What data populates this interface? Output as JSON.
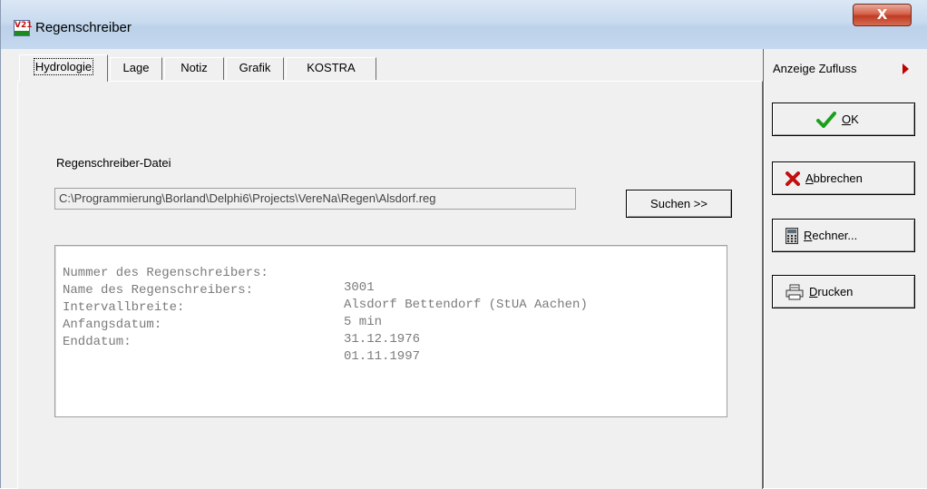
{
  "window": {
    "title": "Regenschreiber",
    "app_icon_text": "V21",
    "close_glyph": "X"
  },
  "tabs": [
    {
      "label": "Hydrologie",
      "active": true
    },
    {
      "label": "Lage"
    },
    {
      "label": "Notiz"
    },
    {
      "label": "Grafik"
    },
    {
      "label": "KOSTRA"
    }
  ],
  "side": {
    "toggle_label": "Anzeige Zufluss",
    "ok_mnemonic": "O",
    "ok_rest": "K",
    "cancel_mnemonic": "A",
    "cancel_rest": "bbrechen",
    "calc_mnemonic": "R",
    "calc_rest": "echner...",
    "print_mnemonic": "D",
    "print_rest": "rucken"
  },
  "file": {
    "label": "Regenschreiber-Datei",
    "path": "C:\\Programmierung\\Borland\\Delphi6\\Projects\\VereNa\\Regen\\Alsdorf.reg",
    "browse_label": "Suchen >>"
  },
  "info": [
    {
      "key": "Nummer des Regenschreibers:",
      "value": "3001"
    },
    {
      "key": "Name des Regenschreibers:",
      "value": "Alsdorf Bettendorf (StUA Aachen)"
    },
    {
      "key": "Intervallbreite:",
      "value": "5 min"
    },
    {
      "key": "Anfangsdatum:",
      "value": "31.12.1976"
    },
    {
      "key": "Enddatum:",
      "value": "01.11.1997"
    }
  ],
  "icons": {
    "ok": "check-icon",
    "cancel": "x-icon",
    "calc": "calculator-icon",
    "print": "printer-icon",
    "toggle": "triangle-right-icon"
  },
  "colors": {
    "check": "#1aa01a",
    "cancel": "#c01010",
    "arrow": "#c00000",
    "info_text": "#7b7b7b"
  }
}
